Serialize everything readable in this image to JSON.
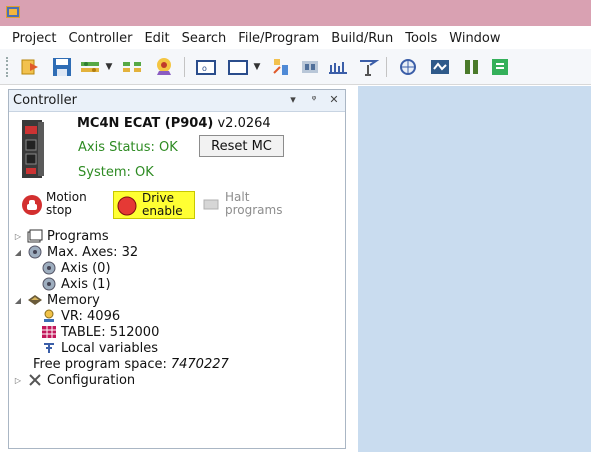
{
  "menu": [
    "Project",
    "Controller",
    "Edit",
    "Search",
    "File/Program",
    "Build/Run",
    "Tools",
    "Window"
  ],
  "toolbar_icons": [
    "new-project-icon",
    "save-icon",
    "connect-icon",
    "disconnect-icon",
    "sync-icon",
    "terminal-icon",
    "window-icon",
    "chart-icon",
    "io-icon",
    "scope-icon",
    "axis-icon",
    "oscilloscope-icon",
    "status-icon",
    "program-icon"
  ],
  "panel": {
    "title": "Controller",
    "controls": [
      "▾",
      "ᵠ",
      "✕"
    ]
  },
  "device": {
    "name": "MC4N ECAT (P904)",
    "version": "v2.0264",
    "axis_status": "Axis Status: OK",
    "reset_label": "Reset MC",
    "system_status": "System: OK"
  },
  "controls": {
    "motion_stop": [
      "Motion",
      "stop"
    ],
    "drive_enable": [
      "Drive",
      "enable"
    ],
    "halt": [
      "Halt",
      "programs"
    ]
  },
  "tree": {
    "programs": "Programs",
    "max_axes": "Max. Axes: 32",
    "axis0": "Axis (0)",
    "axis1": "Axis (1)",
    "memory": "Memory",
    "vr": "VR: 4096",
    "table": "TABLE: 512000",
    "local_vars": "Local variables",
    "free_space_label": "Free program space: ",
    "free_space_value": "7470227",
    "configuration": "Configuration"
  },
  "colors": {
    "title_bar": "#d9a1b2",
    "status_ok": "#2e8b23",
    "drive_enable_bg": "#ffff33",
    "workspace": "#c9dcef"
  }
}
